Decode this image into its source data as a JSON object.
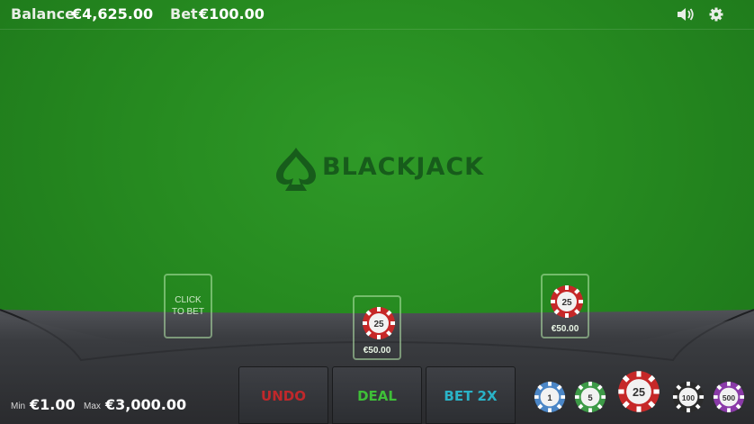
{
  "hud": {
    "balance_label": "Balance",
    "balance_value": "€4,625.00",
    "bet_label": "Bet",
    "bet_value": "€100.00"
  },
  "logo": {
    "text": "BLACKJACK"
  },
  "spots": {
    "left_text_line1": "CLICK",
    "left_text_line2": "TO BET",
    "center_chip": "25",
    "center_amount": "€50.00",
    "right_chip": "25",
    "right_amount": "€50.00"
  },
  "limits": {
    "min_label": "Min",
    "min_value": "€1.00",
    "max_label": "Max",
    "max_value": "€3,000.00"
  },
  "actions": {
    "undo": "UNDO",
    "deal": "DEAL",
    "bet2x": "BET 2X"
  },
  "chips": [
    "1",
    "5",
    "25",
    "100",
    "500"
  ],
  "colors": {
    "felt": "#268a20",
    "undo": "#c0282b",
    "deal": "#3fbf38",
    "bet2x": "#2ab3c7",
    "chip_1": "#4b86c6",
    "chip_5": "#3d9a47",
    "chip_25": "#c62828",
    "chip_100": "#2b2b2b",
    "chip_500": "#8a3aa8"
  }
}
